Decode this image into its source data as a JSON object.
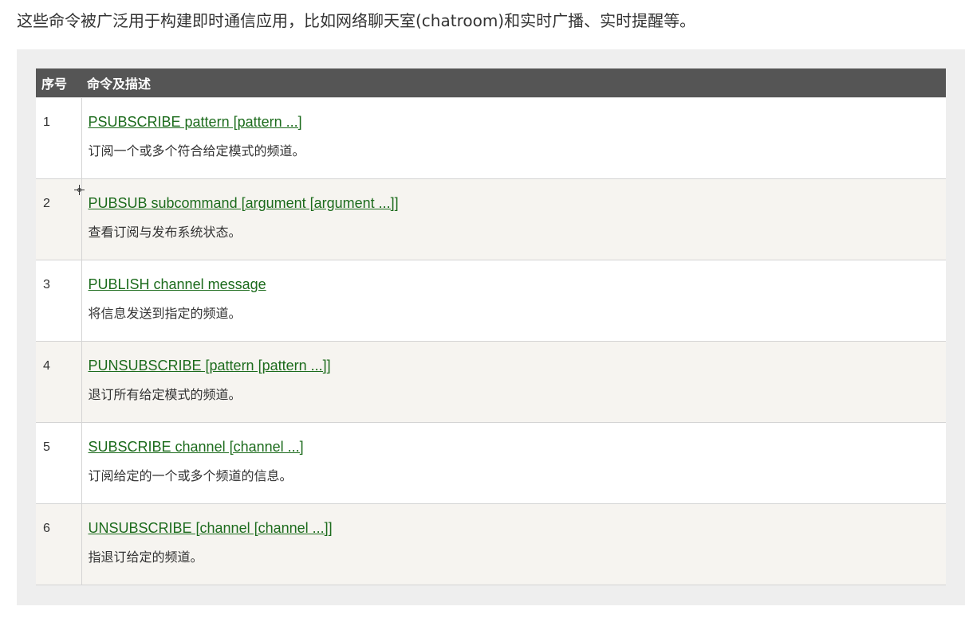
{
  "intro": "这些命令被广泛用于构建即时通信应用，比如网络聊天室(chatroom)和实时广播、实时提醒等。",
  "table": {
    "headers": [
      "序号",
      "命令及描述"
    ],
    "rows": [
      {
        "num": "1",
        "command": "PSUBSCRIBE pattern [pattern ...]",
        "description": "订阅一个或多个符合给定模式的频道。"
      },
      {
        "num": "2",
        "command": "PUBSUB subcommand [argument [argument ...]]",
        "description": "查看订阅与发布系统状态。"
      },
      {
        "num": "3",
        "command": "PUBLISH channel message",
        "description": "将信息发送到指定的频道。"
      },
      {
        "num": "4",
        "command": "PUNSUBSCRIBE [pattern [pattern ...]]",
        "description": "退订所有给定模式的频道。"
      },
      {
        "num": "5",
        "command": "SUBSCRIBE channel [channel ...]",
        "description": "订阅给定的一个或多个频道的信息。"
      },
      {
        "num": "6",
        "command": "UNSUBSCRIBE [channel [channel ...]]",
        "description": "指退订给定的频道。"
      }
    ]
  },
  "colors": {
    "link": "#1c6b1c",
    "header_bg": "#555555",
    "panel_bg": "#eeeeee",
    "alt_row_bg": "#f6f4f0"
  },
  "cursor": {
    "icon": "crosshair-cursor-icon"
  }
}
